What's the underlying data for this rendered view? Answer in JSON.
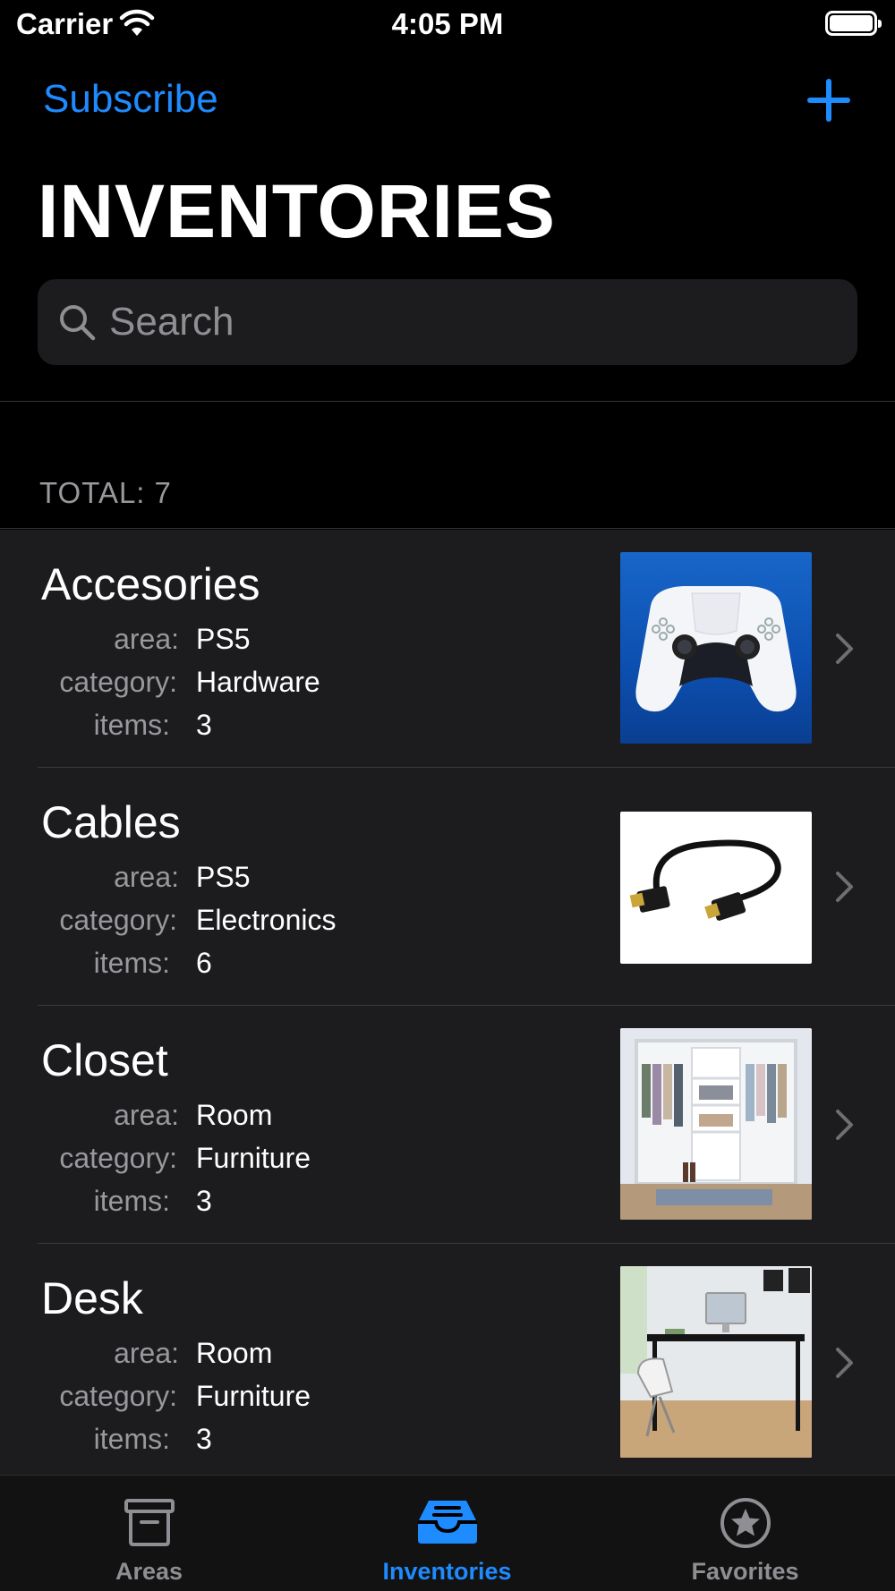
{
  "status_bar": {
    "carrier": "Carrier",
    "time": "4:05 PM"
  },
  "nav": {
    "subscribe_label": "Subscribe",
    "add_icon": "plus-icon"
  },
  "title": "INVENTORIES",
  "search": {
    "placeholder": "Search"
  },
  "total": {
    "label": "TOTAL:",
    "value": "7"
  },
  "field_labels": {
    "area": "area:",
    "category": "category:",
    "items": "items:"
  },
  "inventories": [
    {
      "name": "Accesories",
      "area": "PS5",
      "category": "Hardware",
      "items": "3",
      "thumbnail": "game-controller"
    },
    {
      "name": "Cables",
      "area": "PS5",
      "category": "Electronics",
      "items": "6",
      "thumbnail": "hdmi-cable"
    },
    {
      "name": "Closet",
      "area": "Room",
      "category": "Furniture",
      "items": "3",
      "thumbnail": "closet"
    },
    {
      "name": "Desk",
      "area": "Room",
      "category": "Furniture",
      "items": "3",
      "thumbnail": "desk"
    }
  ],
  "tabs": [
    {
      "label": "Areas",
      "icon": "archive-box-icon",
      "active": false
    },
    {
      "label": "Inventories",
      "icon": "tray-icon",
      "active": true
    },
    {
      "label": "Favorites",
      "icon": "star-circle-icon",
      "active": false
    }
  ],
  "colors": {
    "accent": "#1e8bff",
    "background": "#000000",
    "cell": "#1c1c1e",
    "secondary_text": "#98989d"
  }
}
